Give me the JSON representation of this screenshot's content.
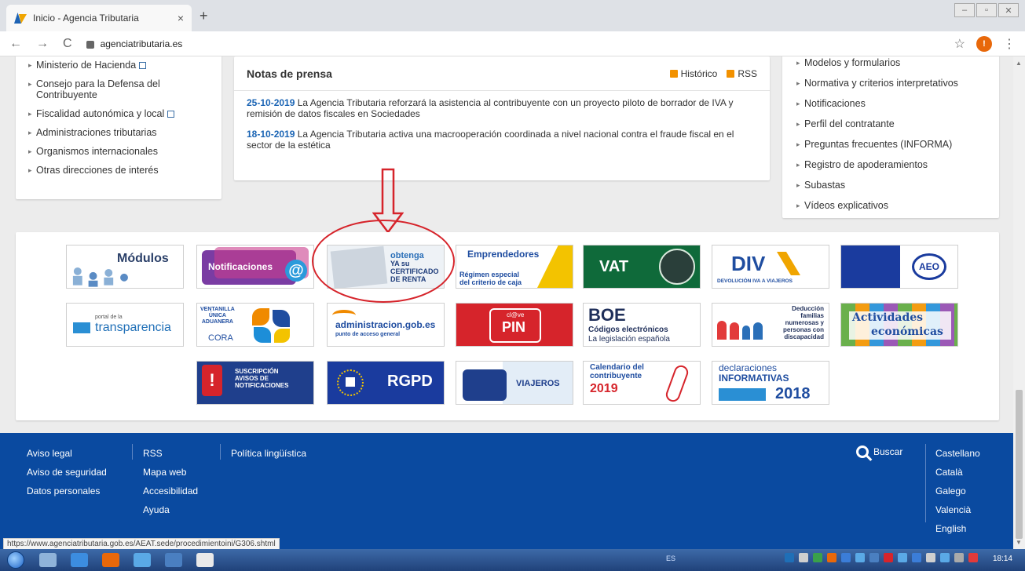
{
  "browser": {
    "tab_title": "Inicio - Agencia Tributaria",
    "tab_close": "×",
    "new_tab": "+",
    "url": "agenciatributaria.es",
    "profile_initial": "!",
    "back": "←",
    "forward": "→",
    "reload": "C",
    "star": "☆",
    "menu": "⋮"
  },
  "left_links": [
    "Ministerio de Hacienda",
    "Consejo para la Defensa del Contribuyente",
    "Fiscalidad autonómica y local",
    "Administraciones tributarias",
    "Organismos internacionales",
    "Otras direcciones de interés"
  ],
  "press": {
    "title": "Notas de prensa",
    "historico": "Histórico",
    "rss": "RSS",
    "items": [
      {
        "date": "25-10-2019",
        "text": "La Agencia Tributaria reforzará la asistencia al contribuyente con un proyecto piloto de borrador de IVA y remisión de datos fiscales en Sociedades"
      },
      {
        "date": "18-10-2019",
        "text": "La Agencia Tributaria activa una macrooperación coordinada a nivel nacional contra el fraude fiscal en el sector de la estética"
      }
    ]
  },
  "right_links": [
    "Modelos y formularios",
    "Normativa y criterios interpretativos",
    "Notificaciones",
    "Perfil del contratante",
    "Preguntas frecuentes (INFORMA)",
    "Registro de apoderamientos",
    "Subastas",
    "Vídeos explicativos"
  ],
  "banners": {
    "modulos": "Módulos",
    "notificaciones": "Notificaciones",
    "certificado": [
      "obtenga",
      "YA su",
      "CERTIFICADO",
      "DE RENTA"
    ],
    "emprendedores": "Emprendedores",
    "emprendedores_sub": [
      "Régimen especial",
      "del criterio de caja"
    ],
    "vat": "VAT",
    "div": "DIV",
    "div_sub": "DEVOLUCIÓN IVA A VIAJEROS",
    "aeo": "AEO",
    "transparencia_small": "portal de la",
    "transparencia": "transparencia",
    "ventanilla": [
      "VENTANILLA",
      "ÚNICA",
      "ADUANERA"
    ],
    "cora": "CORA",
    "administracion": "administracion.gob.es",
    "administracion_sub": "punto de acceso general",
    "clave_small": "cl@ve",
    "clave_pin": "PIN",
    "boe": "BOE",
    "boe_l1": "Códigos electrónicos",
    "boe_l2": "La legislación española",
    "deduccion": [
      "Deducción",
      "familias",
      "numerosas y",
      "personas con",
      "discapacidad"
    ],
    "actividades": [
      "Actividades",
      "económicas"
    ],
    "suscripcion": [
      "SUSCRIPCIÓN",
      "AVISOS DE",
      "NOTIFICACIONES"
    ],
    "rgpd": "RGPD",
    "viajeros": "VIAJEROS",
    "calendario": [
      "Calendario del",
      "contribuyente"
    ],
    "calendario_year": "2019",
    "declaraciones": [
      "declaraciones",
      "INFORMATIVAS"
    ],
    "declaraciones_year": "2018"
  },
  "footer": {
    "col1": [
      "Aviso legal",
      "Aviso de seguridad",
      "Datos personales"
    ],
    "col2": [
      "RSS",
      "Mapa web",
      "Accesibilidad",
      "Ayuda"
    ],
    "col3": [
      "Política lingüística"
    ],
    "buscar": "Buscar",
    "languages": [
      "Castellano",
      "Català",
      "Galego",
      "Valencià",
      "English"
    ]
  },
  "status_url": "https://www.agenciatributaria.gob.es/AEAT.sede/procedimientoini/G306.shtml",
  "taskbar": {
    "lang": "ES",
    "time": "18:14"
  },
  "colors": {
    "brand_blue": "#0a4aa0",
    "link_blue": "#1a64b4",
    "accent_orange": "#f29100",
    "highlight_red": "#d6242b"
  }
}
